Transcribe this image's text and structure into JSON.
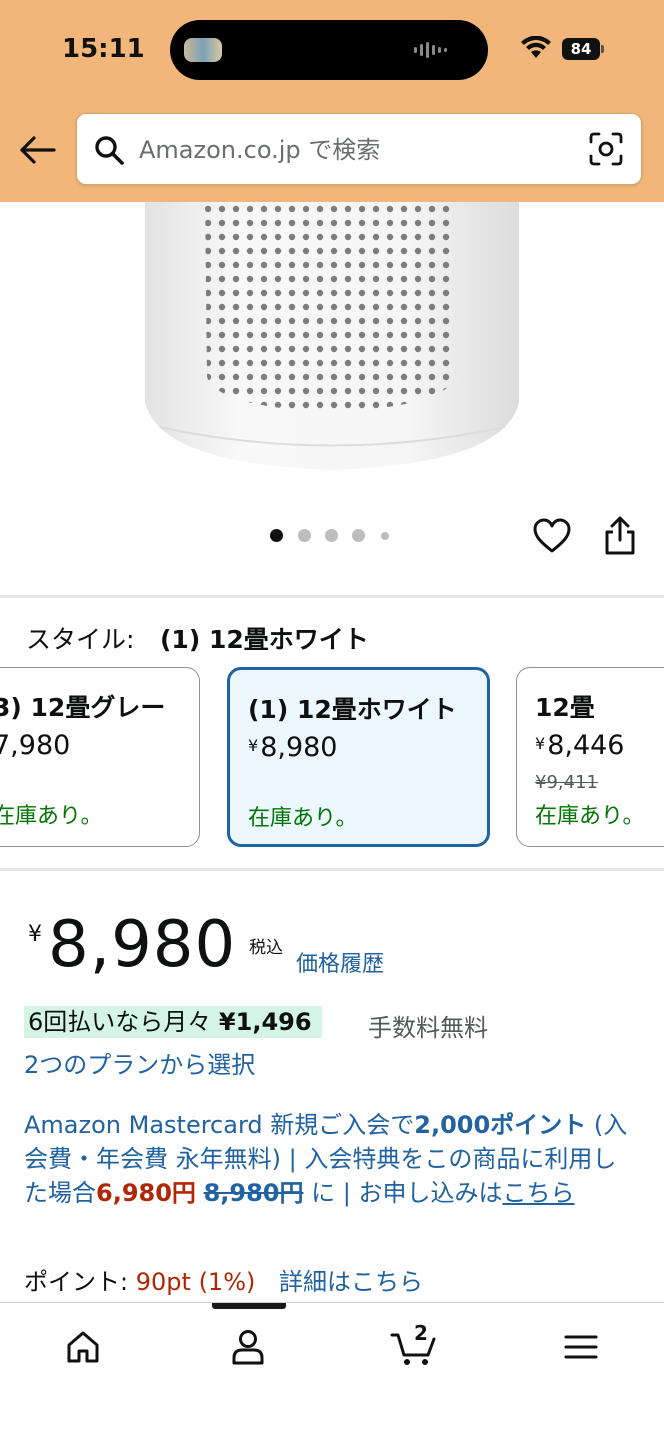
{
  "status_bar": {
    "time": "15:11",
    "battery": "84"
  },
  "search": {
    "placeholder": "Amazon.co.jp で検索"
  },
  "carousel": {
    "total_images": 5,
    "current_index": 0
  },
  "style_selector": {
    "label": "スタイル:",
    "selected_value": "(1) 12畳ホワイト",
    "options": [
      {
        "title": "3) 12畳グレー",
        "price": "7,980",
        "stock": "在庫あり。"
      },
      {
        "title": "(1) 12畳ホワイト",
        "yen": "¥",
        "price": "8,980",
        "stock": "在庫あり。"
      },
      {
        "title": "12畳",
        "yen": "¥",
        "price": "8,446",
        "list_price": "¥9,411",
        "stock": "在庫あり。"
      }
    ]
  },
  "price": {
    "yen": "¥",
    "amount": "8,980",
    "tax_label": "税込",
    "history_link": "価格履歴"
  },
  "installment": {
    "text": "6回払いなら月々",
    "amount": "¥1,496",
    "fee_note": "手数料無料",
    "plan_link": "2つのプランから選択"
  },
  "mastercard": {
    "part1": "Amazon Mastercard 新規ご入会で",
    "points": "2,000ポイント",
    "part2": " (入会費・年会費 永年無料) | 入会特典をこの商品に利用した場合",
    "discount_price": "6,980円",
    "space": " ",
    "original_price": "8,980円",
    "part3": " に | お申し込みは",
    "link": "こちら"
  },
  "points": {
    "label": "ポイント:",
    "value": "90pt",
    "percent": "(1%)",
    "detail_link": "詳細はこちら"
  },
  "bottom_nav": {
    "cart_count": "2"
  }
}
